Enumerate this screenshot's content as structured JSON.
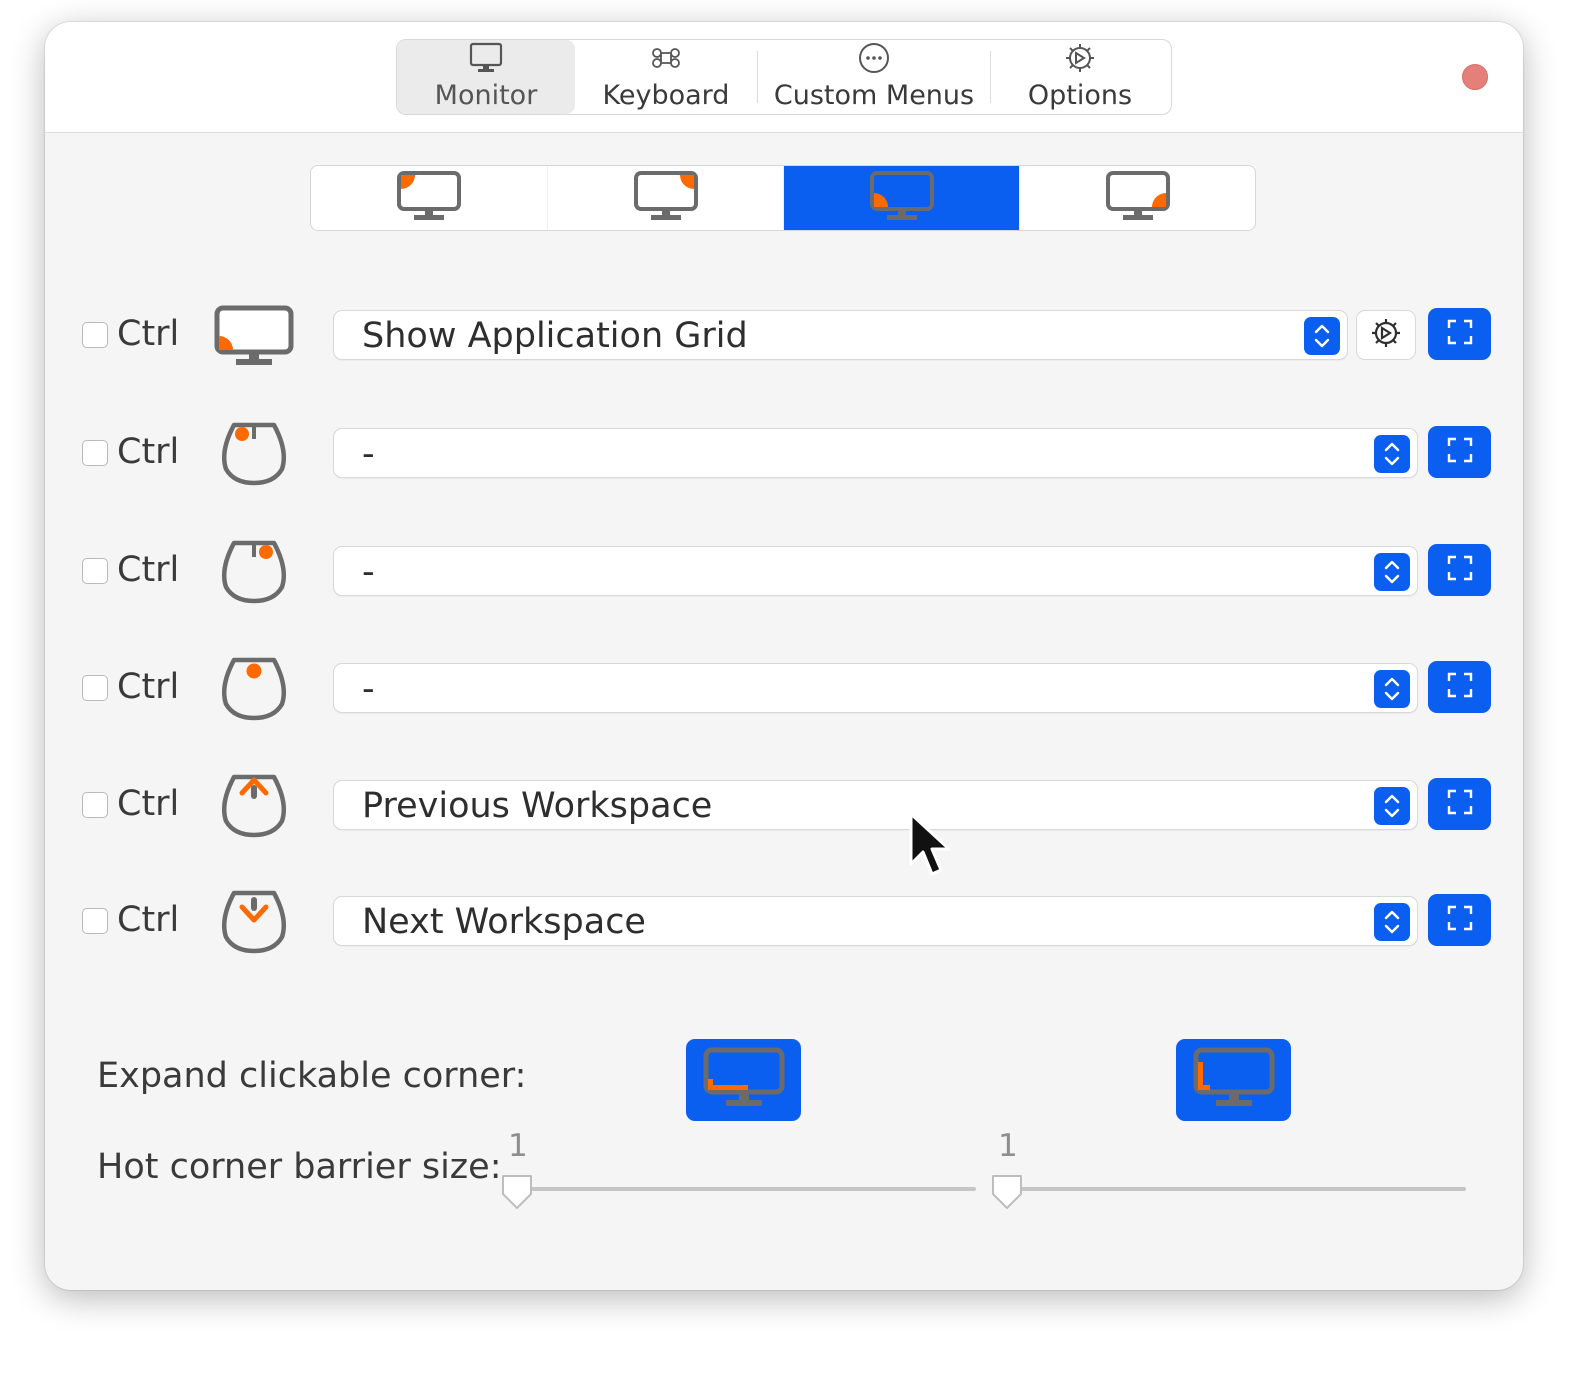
{
  "window": {
    "tabs": [
      {
        "label": "Monitor",
        "icon": "monitor-icon",
        "active": true
      },
      {
        "label": "Keyboard",
        "icon": "command-key-icon",
        "active": false
      },
      {
        "label": "Custom Menus",
        "icon": "more-circle-icon",
        "active": false
      },
      {
        "label": "Options",
        "icon": "settings-gear-icon",
        "active": false
      }
    ],
    "close_icon": "close-icon"
  },
  "corner_selector": {
    "buttons": [
      {
        "name": "top-left-corner",
        "icon": "monitor-top-left-icon",
        "active": false
      },
      {
        "name": "top-right-corner",
        "icon": "monitor-top-right-icon",
        "active": false
      },
      {
        "name": "bottom-left-corner",
        "icon": "monitor-bottom-left-icon",
        "active": true
      },
      {
        "name": "bottom-right-corner",
        "icon": "monitor-bottom-right-icon",
        "active": false
      }
    ]
  },
  "triggers": [
    {
      "modifier": "Ctrl",
      "checked": false,
      "icon": "monitor-bottom-left-icon",
      "action": "Show Application Grid",
      "has_settings": true
    },
    {
      "modifier": "Ctrl",
      "checked": false,
      "icon": "mouse-left-click-icon",
      "action": "-",
      "has_settings": false
    },
    {
      "modifier": "Ctrl",
      "checked": false,
      "icon": "mouse-right-click-icon",
      "action": "-",
      "has_settings": false
    },
    {
      "modifier": "Ctrl",
      "checked": false,
      "icon": "mouse-middle-click-icon",
      "action": "-",
      "has_settings": false
    },
    {
      "modifier": "Ctrl",
      "checked": false,
      "icon": "mouse-scroll-up-icon",
      "action": "Previous Workspace",
      "has_settings": false
    },
    {
      "modifier": "Ctrl",
      "checked": false,
      "icon": "mouse-scroll-down-icon",
      "action": "Next Workspace",
      "has_settings": false
    }
  ],
  "expand": {
    "label": "Expand clickable corner:",
    "buttons": [
      {
        "icon": "monitor-horizontal-edge-icon",
        "active": true
      },
      {
        "icon": "monitor-vertical-edge-icon",
        "active": true
      }
    ]
  },
  "barrier": {
    "label": "Hot corner barrier size:",
    "sliders": [
      {
        "value": "1",
        "fraction": 0.0
      },
      {
        "value": "1",
        "fraction": 0.0
      }
    ]
  },
  "colors": {
    "accent": "#0a5ff0",
    "corner_marker": "#ff6a00",
    "icon_gray": "#6b6b6b",
    "close": "#e57f79"
  }
}
